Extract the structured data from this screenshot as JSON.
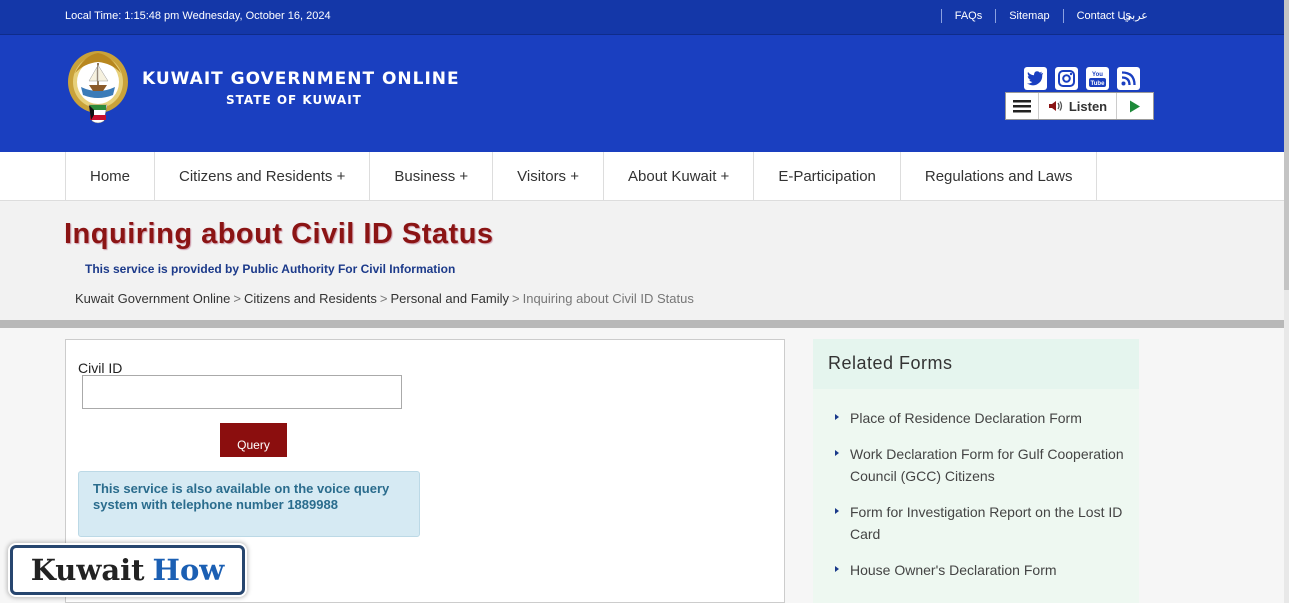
{
  "topbar": {
    "local_time": "Local Time: 1:15:48 pm Wednesday, October 16, 2024",
    "links": [
      "FAQs",
      "Sitemap",
      "Contact Us"
    ],
    "arabic": "عربي"
  },
  "header": {
    "title": "KUWAIT GOVERNMENT ONLINE",
    "subtitle": "STATE OF KUWAIT",
    "social_icons": [
      "twitter-icon",
      "instagram-icon",
      "youtube-icon",
      "rss-icon"
    ],
    "listen_label": "Listen"
  },
  "nav": {
    "items": [
      "Home",
      "Citizens and Residents +",
      "Business +",
      "Visitors +",
      "About Kuwait +",
      "E-Participation",
      "Regulations and Laws"
    ]
  },
  "page": {
    "title": "Inquiring about Civil ID Status",
    "provided_by": "This service is provided by Public Authority For Civil Information",
    "breadcrumb": [
      "Kuwait Government Online",
      "Citizens and Residents",
      "Personal and Family",
      "Inquiring about Civil ID Status"
    ],
    "breadcrumb_sep": ">"
  },
  "form": {
    "civil_id_label": "Civil ID",
    "civil_id_value": "",
    "query_label": "Query",
    "info_text": "This service is also available on the voice query system with telephone number 1889988"
  },
  "related": {
    "heading": "Related Forms",
    "items": [
      "Place of Residence Declaration Form",
      "Work Declaration Form for Gulf Cooperation Council (GCC) Citizens",
      "Form for Investigation Report on the Lost ID Card",
      "House Owner's Declaration Form"
    ]
  },
  "watermark": {
    "word1": "Kuwait",
    "word2": "How"
  },
  "colors": {
    "header_blue": "#1a3fc0",
    "title_red": "#8b1414",
    "query_red": "#8b0e0e"
  }
}
